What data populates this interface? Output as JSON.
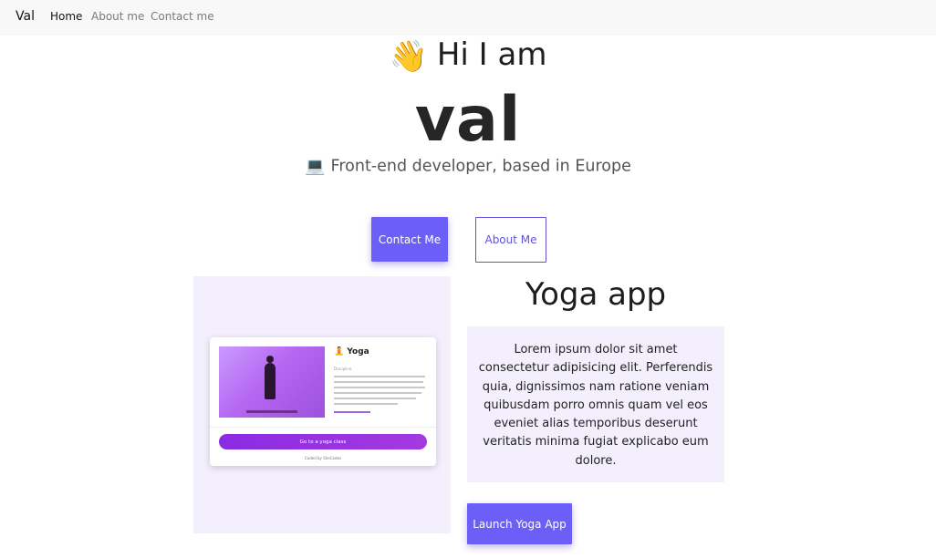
{
  "nav": {
    "brand": "Val",
    "links": [
      {
        "label": "Home",
        "active": true
      },
      {
        "label": "About me",
        "active": false
      },
      {
        "label": "Contact me",
        "active": false
      }
    ]
  },
  "hero": {
    "greeting_icon": "waving-hand-icon",
    "greeting": "Hi I am",
    "name": "val",
    "tagline_icon": "laptop-icon",
    "tagline": "Front-end developer, based in Europe",
    "contact_button": "Contact Me",
    "about_button": "About Me"
  },
  "project": {
    "title": "Yoga app",
    "description": "Lorem ipsum dolor sit amet consectetur adipisicing elit. Perferendis quia, dignissimos nam ratione veniam quibusdam porro omnis quam vel eos eveniet alias temporibus deserunt veritatis minima fugiat explicabo eum dolore.",
    "launch_button": "Launch Yoga App",
    "preview": {
      "card_title": "Yoga",
      "card_subtitle": "Discipline",
      "card_button": "Go to a yoga class",
      "card_footer": "Coded by SheCodes"
    }
  },
  "colors": {
    "accent": "#6c5ff7",
    "panel": "#f3effd",
    "navbar": "#f8f8f9"
  }
}
